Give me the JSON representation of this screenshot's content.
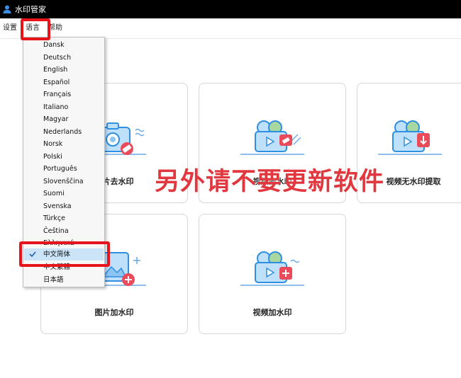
{
  "window": {
    "title": "水印管家"
  },
  "menubar": {
    "items": [
      {
        "label": "设置"
      },
      {
        "label": "语言"
      },
      {
        "label": "帮助"
      }
    ]
  },
  "language_menu": {
    "items": [
      {
        "label": "Dansk"
      },
      {
        "label": "Deutsch"
      },
      {
        "label": "English"
      },
      {
        "label": "Español"
      },
      {
        "label": "Français"
      },
      {
        "label": "Italiano"
      },
      {
        "label": "Magyar"
      },
      {
        "label": "Nederlands"
      },
      {
        "label": "Norsk"
      },
      {
        "label": "Polski"
      },
      {
        "label": "Português"
      },
      {
        "label": "Slovenščina"
      },
      {
        "label": "Suomi"
      },
      {
        "label": "Svenska"
      },
      {
        "label": "Türkçe"
      },
      {
        "label": "Čeština"
      },
      {
        "label": "Ελληνικά"
      },
      {
        "label": "中文简体"
      },
      {
        "label": "中文繁體"
      },
      {
        "label": "日本語"
      }
    ],
    "selected": "中文简体"
  },
  "cards": [
    {
      "label": "图片去水印",
      "icon": "image-remove-watermark-icon"
    },
    {
      "label": "视频去水印",
      "icon": "video-remove-watermark-icon"
    },
    {
      "label": "视频无水印提取",
      "icon": "video-extract-icon"
    },
    {
      "label": "图片加水印",
      "icon": "image-add-watermark-icon"
    },
    {
      "label": "视频加水印",
      "icon": "video-add-watermark-icon"
    }
  ],
  "overlay_note": "另外请不要更新软件",
  "colors": {
    "accent_blue": "#2f8fe0",
    "accent_red": "#e0383e",
    "highlight": "#e8141c",
    "menu_bg": "#f7f7f7"
  }
}
